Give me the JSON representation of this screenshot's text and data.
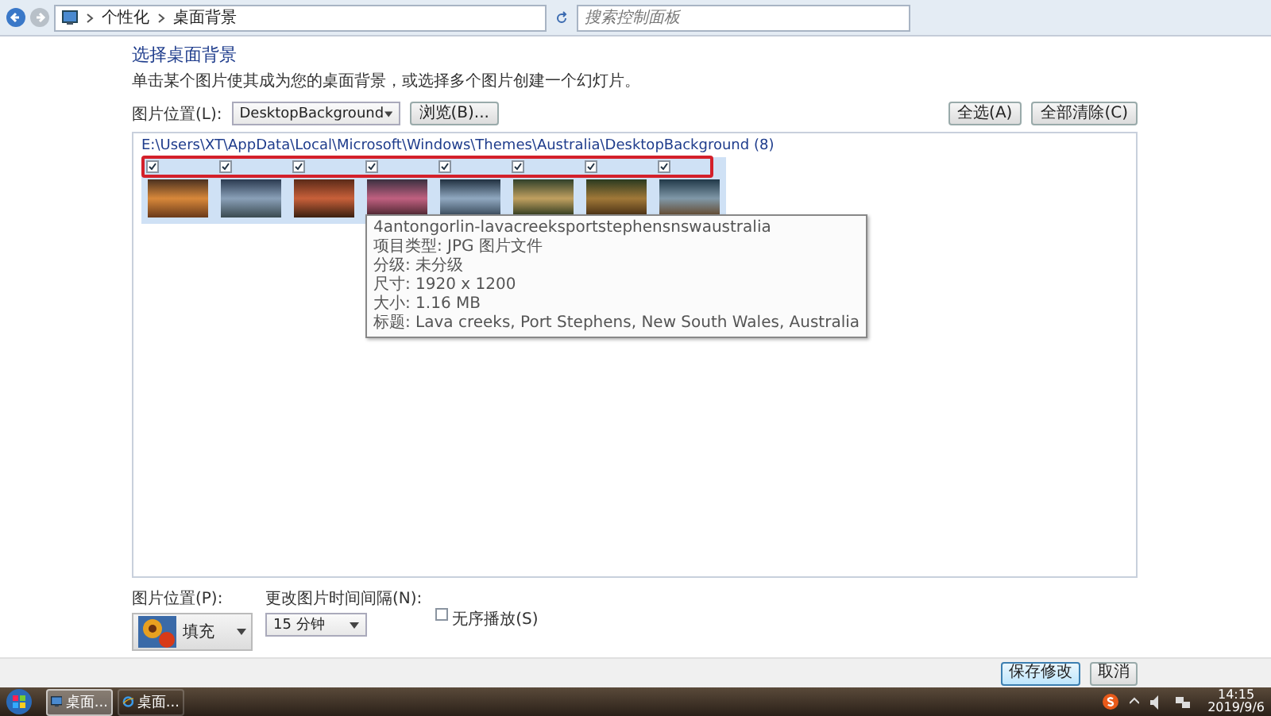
{
  "address_bar": {
    "breadcrumb": [
      "个性化",
      "桌面背景"
    ],
    "search": {
      "placeholder": "搜索控制面板"
    }
  },
  "heading": "选择桌面背景",
  "instruction": "单击某个图片使其成为您的桌面背景，或选择多个图片创建一个幻灯片。",
  "picture_location": {
    "label": "图片位置(L):",
    "value": "DesktopBackground",
    "browse": "浏览(B)..."
  },
  "select_all": "全选(A)",
  "clear_all": "全部清除(C)",
  "group": {
    "path": "E:\\Users\\XT\\AppData\\Local\\Microsoft\\Windows\\Themes\\Australia\\DesktopBackground (8)",
    "thumbnails": [
      {
        "checked": true,
        "selected": true
      },
      {
        "checked": true,
        "selected": true
      },
      {
        "checked": true,
        "selected": true
      },
      {
        "checked": true,
        "selected": true
      },
      {
        "checked": true,
        "selected": true
      },
      {
        "checked": true,
        "selected": true
      },
      {
        "checked": true,
        "selected": true
      },
      {
        "checked": true,
        "selected": true
      }
    ]
  },
  "tooltip": {
    "name": "4antongorlin-lavacreeksportstephensnswaustralia",
    "details": [
      "项目类型: JPG 图片文件",
      "分级: 未分级",
      "尺寸: 1920 x 1200",
      "大小: 1.16 MB",
      "标题: Lava creeks, Port Stephens, New South Wales, Australia"
    ]
  },
  "position": {
    "label": "图片位置(P):",
    "value": "填充"
  },
  "interval": {
    "label": "更改图片时间间隔(N):",
    "value": "15 分钟"
  },
  "shuffle": {
    "label": "无序播放(S)",
    "checked": false
  },
  "buttons": [
    {
      "label": "保存修改",
      "kind": "default"
    },
    {
      "label": "取消",
      "kind": "normal"
    }
  ],
  "taskbar": {
    "items": [
      {
        "label": "桌面...",
        "selected": true
      },
      {
        "label": "桌面...",
        "selected": false
      }
    ],
    "time": "14:15",
    "date": "2019/9/6"
  }
}
